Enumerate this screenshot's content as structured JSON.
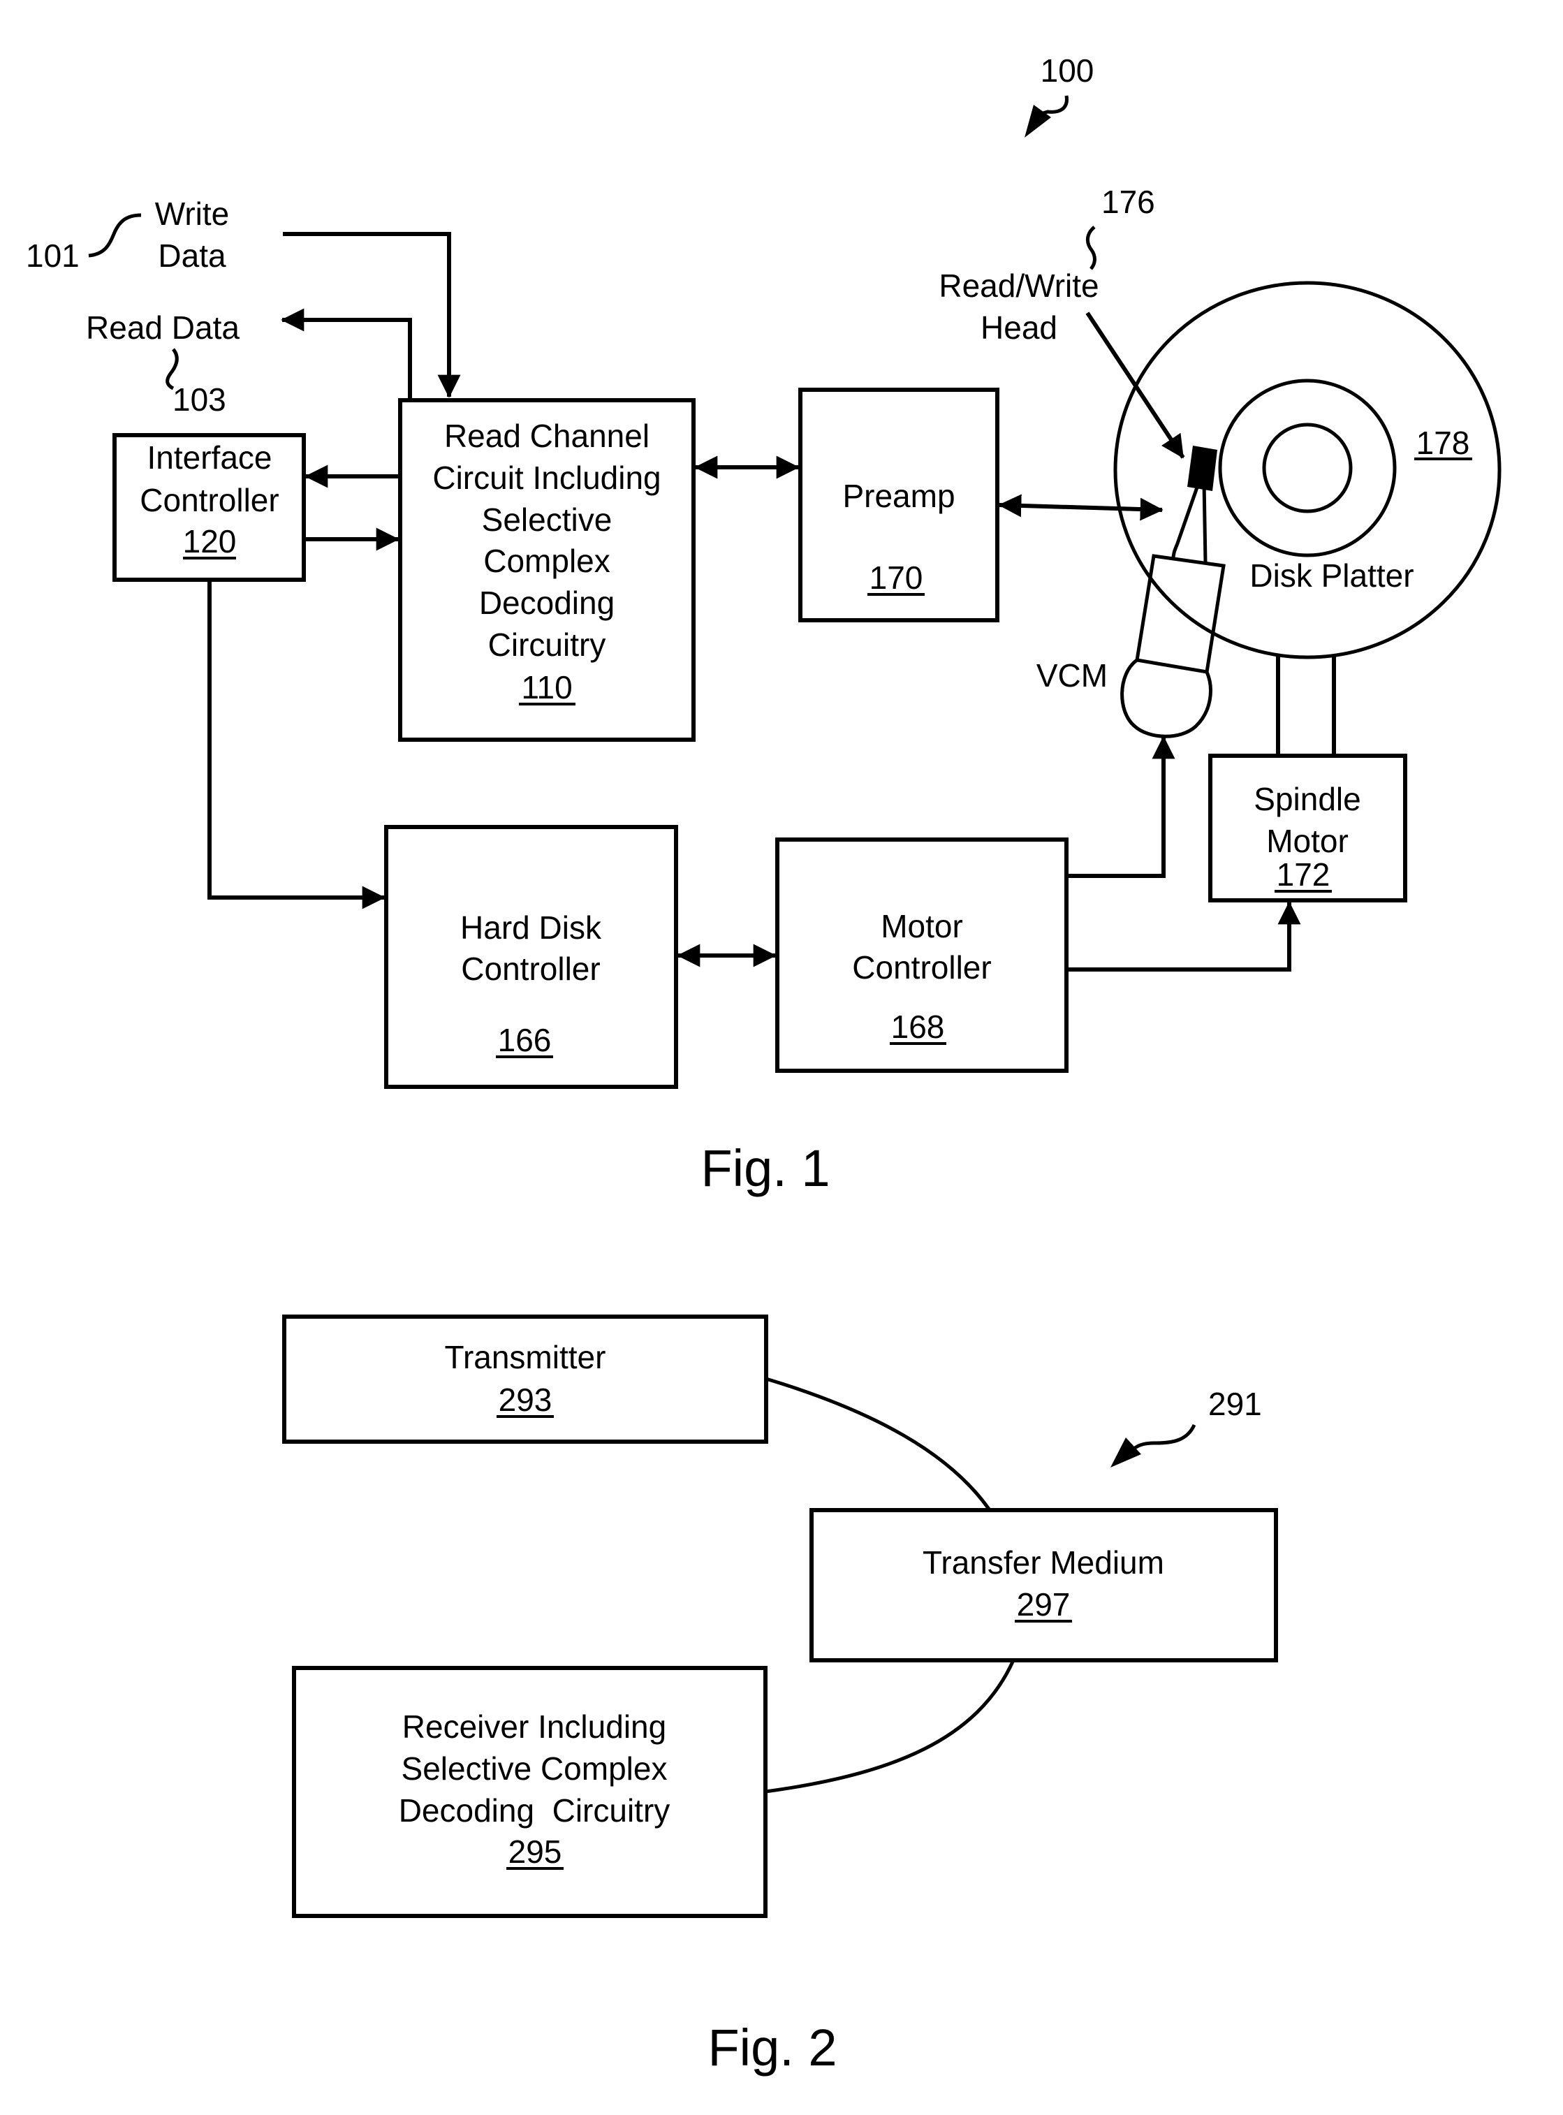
{
  "figure1": {
    "caption": "Fig. 1",
    "system_ref": "100",
    "write_data": {
      "lines": [
        "Write",
        "Data"
      ],
      "ref": "101"
    },
    "read_data": {
      "label": "Read Data",
      "ref": "103"
    },
    "interface_controller": {
      "lines": [
        "Interface",
        "Controller"
      ],
      "ref": "120"
    },
    "read_channel": {
      "lines": [
        "Read Channel",
        "Circuit Including",
        "Selective",
        "Complex",
        "Decoding",
        "Circuitry"
      ],
      "ref": "110"
    },
    "preamp": {
      "lines": [
        "Preamp"
      ],
      "ref": "170"
    },
    "read_write_head": {
      "lines": [
        "Read/Write",
        "Head"
      ],
      "ref": "176"
    },
    "disk_platter": {
      "label": "Disk Platter",
      "ref": "178"
    },
    "vcm": {
      "label": "VCM"
    },
    "spindle_motor": {
      "lines": [
        "Spindle",
        "Motor"
      ],
      "ref": "172"
    },
    "hard_disk_controller": {
      "lines": [
        "Hard Disk",
        "Controller"
      ],
      "ref": "166"
    },
    "motor_controller": {
      "lines": [
        "Motor",
        "Controller"
      ],
      "ref": "168"
    }
  },
  "figure2": {
    "caption": "Fig. 2",
    "system_ref": "291",
    "transmitter": {
      "lines": [
        "Transmitter"
      ],
      "ref": "293"
    },
    "transfer_medium": {
      "lines": [
        "Transfer Medium"
      ],
      "ref": "297"
    },
    "receiver": {
      "lines": [
        "Receiver Including",
        "Selective Complex",
        "Decoding  Circuitry"
      ],
      "ref": "295"
    }
  }
}
